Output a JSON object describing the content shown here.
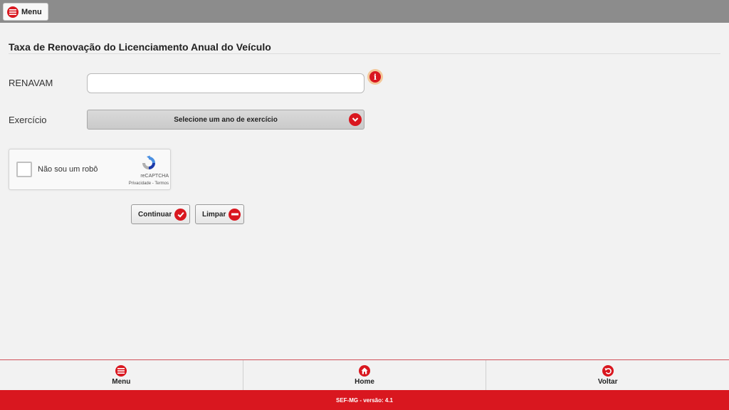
{
  "topbar": {
    "menu_label": "Menu"
  },
  "page": {
    "title": "Taxa de Renovação do Licenciamento Anual do Veículo"
  },
  "form": {
    "renavam_label": "RENAVAM",
    "renavam_value": "",
    "exercicio_label": "Exercício",
    "exercicio_selected": "Selecione um ano de exercício"
  },
  "captcha": {
    "label": "Não sou um robô",
    "brand": "reCAPTCHA",
    "links": "Privacidade - Termos"
  },
  "actions": {
    "continue_label": "Continuar",
    "clear_label": "Limpar"
  },
  "bottom_nav": [
    {
      "label": "Menu",
      "icon": "menu-icon"
    },
    {
      "label": "Home",
      "icon": "home-icon"
    },
    {
      "label": "Voltar",
      "icon": "back-icon"
    }
  ],
  "footer": {
    "text": "SEF-MG - versão: 4.1"
  },
  "colors": {
    "accent": "#d9171f",
    "topbar": "#8c8c8c",
    "background": "#f2f2f2"
  }
}
